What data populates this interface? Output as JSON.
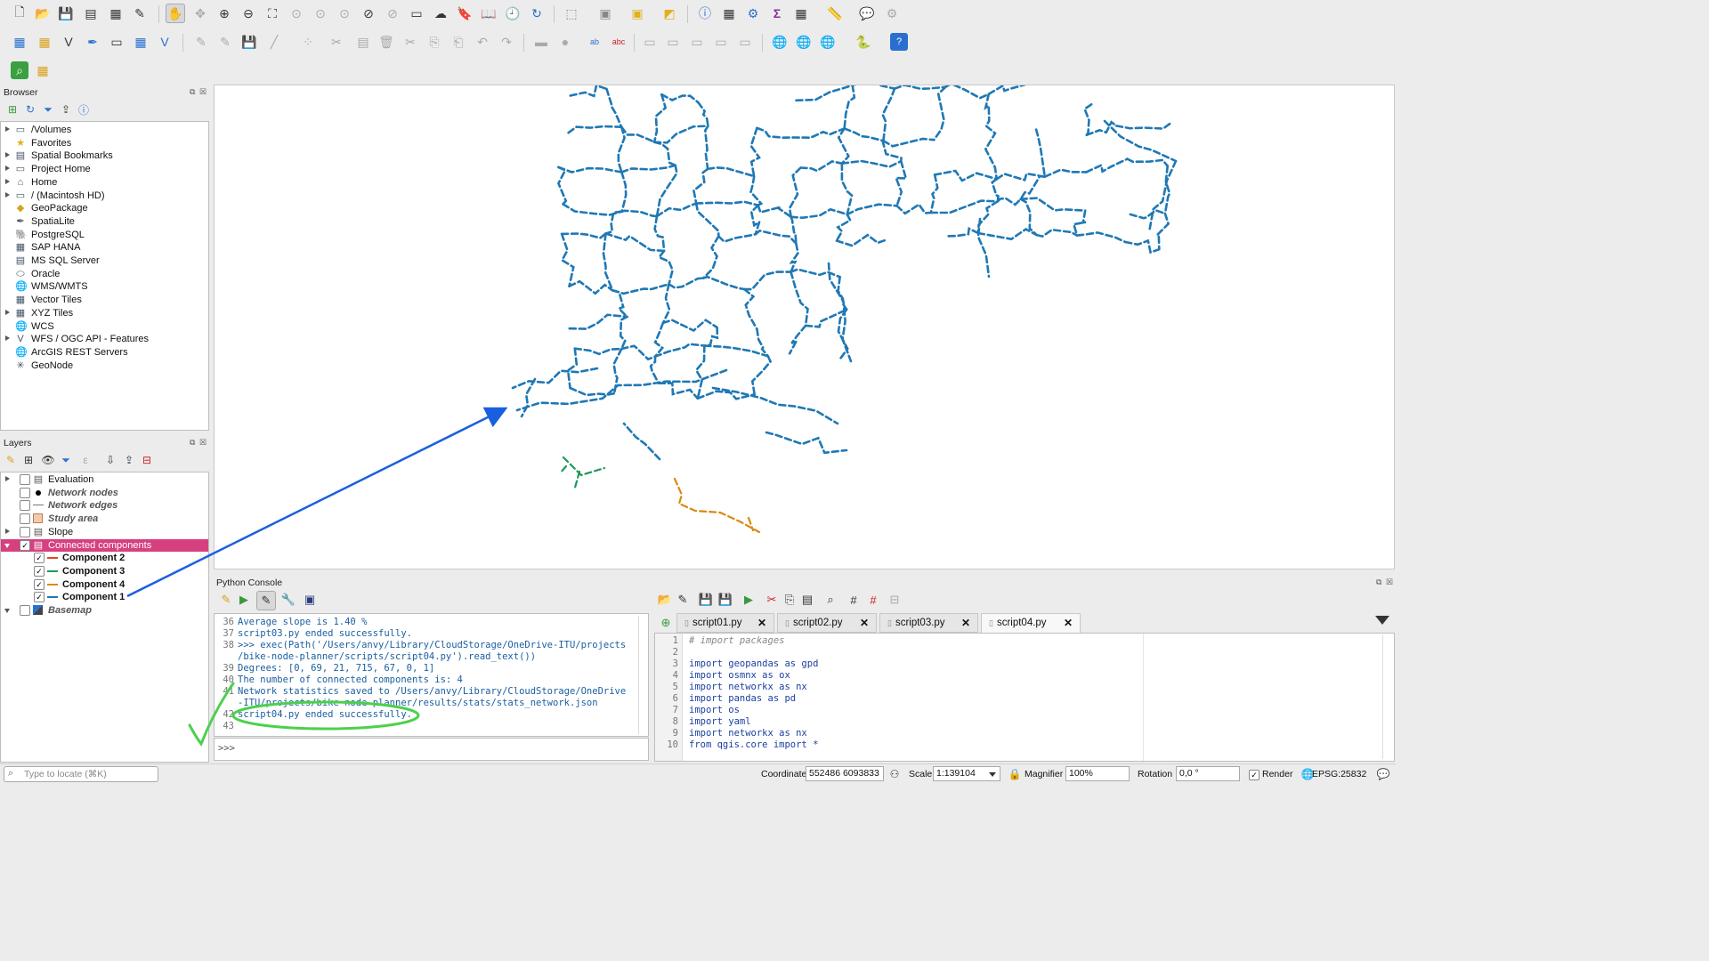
{
  "browser": {
    "title": "Browser",
    "items": [
      {
        "label": "/Volumes",
        "icon": "folder-icon",
        "expandable": true
      },
      {
        "label": "Favorites",
        "icon": "star-icon",
        "expandable": false
      },
      {
        "label": "Spatial Bookmarks",
        "icon": "bookmark-icon",
        "expandable": true
      },
      {
        "label": "Project Home",
        "icon": "folder-icon",
        "expandable": true
      },
      {
        "label": "Home",
        "icon": "home-folder-icon",
        "expandable": true
      },
      {
        "label": "/ (Macintosh HD)",
        "icon": "folder-icon",
        "expandable": true
      },
      {
        "label": "GeoPackage",
        "icon": "geopackage-icon",
        "expandable": false
      },
      {
        "label": "SpatiaLite",
        "icon": "spatialite-icon",
        "expandable": false
      },
      {
        "label": "PostgreSQL",
        "icon": "postgresql-icon",
        "expandable": false
      },
      {
        "label": "SAP HANA",
        "icon": "sap-hana-icon",
        "expandable": false
      },
      {
        "label": "MS SQL Server",
        "icon": "mssql-icon",
        "expandable": false
      },
      {
        "label": "Oracle",
        "icon": "oracle-icon",
        "expandable": false
      },
      {
        "label": "WMS/WMTS",
        "icon": "wms-icon",
        "expandable": false
      },
      {
        "label": "Vector Tiles",
        "icon": "vector-tiles-icon",
        "expandable": false
      },
      {
        "label": "XYZ Tiles",
        "icon": "xyz-tiles-icon",
        "expandable": true
      },
      {
        "label": "WCS",
        "icon": "wcs-icon",
        "expandable": false
      },
      {
        "label": "WFS / OGC API - Features",
        "icon": "wfs-icon",
        "expandable": true
      },
      {
        "label": "ArcGIS REST Servers",
        "icon": "arcgis-icon",
        "expandable": false
      },
      {
        "label": "GeoNode",
        "icon": "geonode-icon",
        "expandable": false
      }
    ]
  },
  "layers": {
    "title": "Layers",
    "items": [
      {
        "label": "Evaluation",
        "checked": false,
        "style": "normal",
        "expander": "right",
        "indent": 0,
        "symbol": "group-icon"
      },
      {
        "label": "Network nodes",
        "checked": false,
        "style": "bold-italic",
        "expander": "none",
        "indent": 0,
        "symbol": "point-symbol-icon"
      },
      {
        "label": "Network edges",
        "checked": false,
        "style": "bold-italic",
        "expander": "none",
        "indent": 0,
        "symbol": "line-symbol-icon"
      },
      {
        "label": "Study area",
        "checked": false,
        "style": "bold-italic",
        "expander": "none",
        "indent": 0,
        "symbol": "polygon-symbol-icon"
      },
      {
        "label": "Slope",
        "checked": false,
        "style": "normal",
        "expander": "right",
        "indent": 0,
        "symbol": "group-icon"
      },
      {
        "label": "Connected components",
        "checked": true,
        "style": "selected",
        "expander": "down",
        "indent": 0,
        "symbol": "group-icon"
      },
      {
        "label": "Component 2",
        "checked": true,
        "style": "bold",
        "expander": "none",
        "indent": 1,
        "symbol": "dash-line-icon",
        "color": "#e04a1a"
      },
      {
        "label": "Component 3",
        "checked": true,
        "style": "bold",
        "expander": "none",
        "indent": 1,
        "symbol": "dash-line-icon",
        "color": "#1a9a5a"
      },
      {
        "label": "Component 4",
        "checked": true,
        "style": "bold",
        "expander": "none",
        "indent": 1,
        "symbol": "dash-line-icon",
        "color": "#d88a10"
      },
      {
        "label": "Component 1",
        "checked": true,
        "style": "bold",
        "expander": "none",
        "indent": 1,
        "symbol": "dash-line-icon",
        "color": "#1f78b4"
      },
      {
        "label": "Basemap",
        "checked": false,
        "style": "bold-italic",
        "expander": "down",
        "indent": 0,
        "symbol": "raster-icon"
      }
    ]
  },
  "python_console": {
    "title": "Python Console",
    "lines": [
      {
        "n": "36",
        "text": "Average slope is 1.40 %"
      },
      {
        "n": "37",
        "text": "script03.py ended successfully."
      },
      {
        "n": "38",
        "text": ">>> exec(Path('/Users/anvy/Library/CloudStorage/OneDrive-ITU/projects"
      },
      {
        "n": "",
        "text": "/bike-node-planner/scripts/script04.py').read_text())"
      },
      {
        "n": "39",
        "text": "Degrees: [0, 69, 21, 715, 67, 0, 1]"
      },
      {
        "n": "40",
        "text": "The number of connected components is: 4"
      },
      {
        "n": "41",
        "text": "Network statistics saved to /Users/anvy/Library/CloudStorage/OneDrive"
      },
      {
        "n": "",
        "text": "-ITU/projects/bike-node-planner/results/stats/stats_network.json"
      },
      {
        "n": "42",
        "text": "script04.py ended successfully."
      },
      {
        "n": "43",
        "text": ""
      }
    ],
    "prompt": ">>>"
  },
  "editor": {
    "tabs": [
      "script01.py",
      "script02.py",
      "script03.py",
      "script04.py"
    ],
    "active_tab": 3,
    "lines": [
      {
        "n": "1",
        "text": "# import packages"
      },
      {
        "n": "2",
        "text": ""
      },
      {
        "n": "3",
        "text": "import geopandas as gpd"
      },
      {
        "n": "4",
        "text": "import osmnx as ox"
      },
      {
        "n": "5",
        "text": "import networkx as nx"
      },
      {
        "n": "6",
        "text": "import pandas as pd"
      },
      {
        "n": "7",
        "text": "import os"
      },
      {
        "n": "8",
        "text": "import yaml"
      },
      {
        "n": "9",
        "text": "import networkx as nx"
      },
      {
        "n": "10",
        "text": "from qgis.core import *"
      }
    ]
  },
  "status_bar": {
    "locate_placeholder": "Type to locate (⌘K)",
    "coordinate_label": "Coordinate",
    "coordinate_value": "552486 6093833",
    "scale_label": "Scale",
    "scale_value": "1:139104",
    "magnifier_label": "Magnifier",
    "magnifier_value": "100%",
    "rotation_label": "Rotation",
    "rotation_value": "0,0 °",
    "render_label": "Render",
    "crs": "EPSG:25832"
  },
  "colors": {
    "component1": "#1f78b4",
    "component2": "#e04a1a",
    "component3": "#1a9a5a",
    "component4": "#d88a10",
    "selection": "#d6407f",
    "annotation_arrow": "#1a5fe0",
    "annotation_circle": "#4cd04c"
  }
}
